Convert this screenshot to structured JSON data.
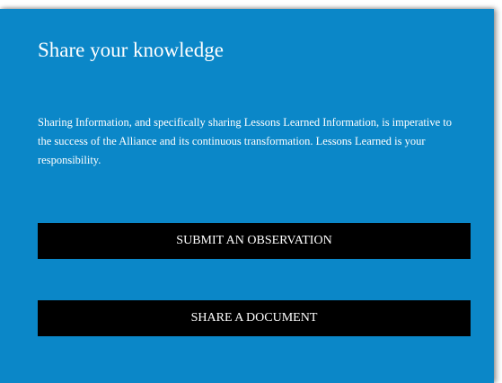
{
  "panel": {
    "title": "Share your knowledge",
    "description": "Sharing Information, and specifically sharing Lessons Learned Information, is imperative to the success of the Alliance and its continuous transformation. Lessons Learned is your responsibility.",
    "background_color": "#0b87c8"
  },
  "actions": {
    "submit_observation_label": "SUBMIT AN OBSERVATION",
    "share_document_label": "SHARE A DOCUMENT",
    "button_color": "#000000"
  }
}
